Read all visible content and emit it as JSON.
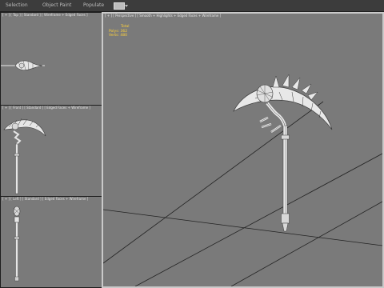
{
  "menu": {
    "tabs": [
      {
        "label": "Selection"
      },
      {
        "label": "Object Paint"
      },
      {
        "label": "Populate"
      }
    ],
    "flag_icon": "viewport-config-icon"
  },
  "viewports": {
    "top_left": {
      "label": "[ + ] [ Top ] [ Standard ] [ Wireframe + Edged Faces ]"
    },
    "middle_left": {
      "label": "[ + ] [ Front ] [ Standard ] [ Edged Faces + Wireframe ]"
    },
    "bottom_left": {
      "label": "[ + ] [ Left ] [ Standard ] [ Edged Faces + Wireframe ]"
    },
    "perspective": {
      "label": "[ + ] [ Perspective ] [ Smooth + Highlights + Edged Faces + Wireframe ]",
      "stats": {
        "heading": "Total",
        "polys_label": "Polys: 362",
        "verts_label": "Verts: 480"
      }
    }
  },
  "colors": {
    "viewport_bg": "#7a7a7a",
    "stats_text": "#ffd23a",
    "model_fill": "#e6e6e6",
    "model_line": "#3a3a3a"
  }
}
